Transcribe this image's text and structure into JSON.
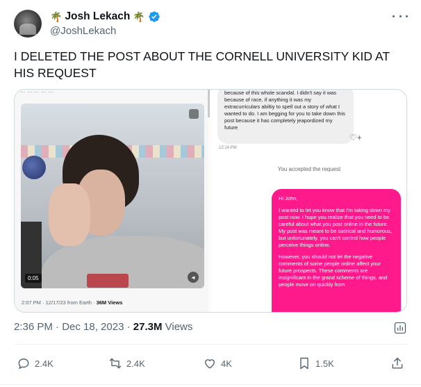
{
  "author": {
    "display_name": "Josh Lekach",
    "emoji_left": "🌴",
    "emoji_right": "🌴",
    "handle": "@JoshLekach",
    "verified": true
  },
  "tweet": {
    "text": "I DELETED THE POST ABOUT THE CORNELL UNIVERSITY KID AT HIS REQUEST"
  },
  "media": {
    "left": {
      "cut_top_text": "... ... ... ... ...",
      "duration": "0:05",
      "meta_prefix": "2:07 PM · 12/17/23 from Earth · ",
      "meta_views": "36M Views"
    },
    "right": {
      "grey_bubble_text": "because of this whole scandal. I didn't say it was because of race, if anything it was my extracurriculars abiltiy to spell out a story of what I wanted to do. I am begging for you to take down this post because it has completely jeapordized my future",
      "grey_bubble_time": "12:14 PM",
      "accepted_text": "You accepted the request",
      "pink_paragraphs": [
        "Hi John,",
        "I wanted to let you know that I'm taking down my post now. I hope you realize that you need to be careful about what you post online in the future. My post was meant to be satirical and humorous, but unfortunately, you can't control how people perceive things online.",
        "However, you should not let the negative comments of some people online affect your future prospects. These comments are insignificant in the grand scheme of things, and people move on quickly from"
      ]
    }
  },
  "timestamp": {
    "time_date": "2:36 PM · Dec 18, 2023 · ",
    "views_count": "27.3M",
    "views_label": " Views"
  },
  "actions": {
    "replies": "2.4K",
    "reposts": "2.4K",
    "likes": "4K",
    "bookmarks": "1.5K"
  },
  "colors": {
    "verified_blue": "#1d9bf0",
    "pink_bubble": "#ff1a8c",
    "secondary_text": "#536471"
  },
  "icons": [
    "verified-icon",
    "more-icon",
    "reply-icon",
    "repost-icon",
    "like-icon",
    "bookmark-icon",
    "share-icon",
    "analytics-icon",
    "mute-icon"
  ]
}
